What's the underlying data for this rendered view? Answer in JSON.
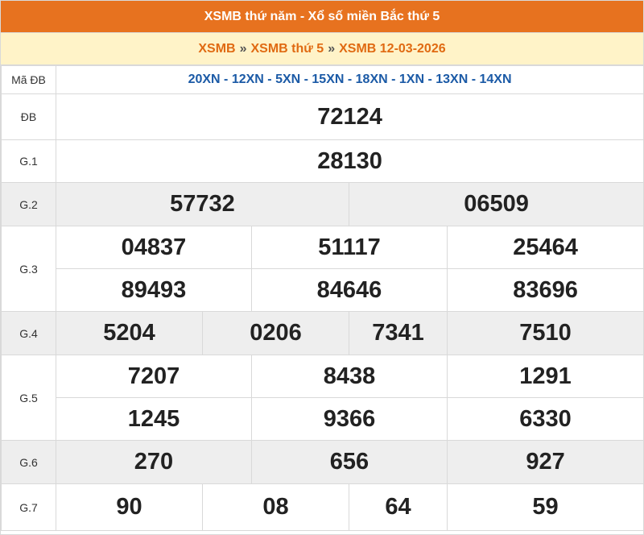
{
  "header": {
    "title": "XSMB thứ năm - Xổ số miền Bắc thứ 5"
  },
  "breadcrumb": {
    "item1": "XSMB",
    "sep": "»",
    "item2": "XSMB thứ 5",
    "item3": "XSMB 12-03-2026"
  },
  "labels": {
    "ma_db": "Mã ĐB",
    "db": "ĐB",
    "g1": "G.1",
    "g2": "G.2",
    "g3": "G.3",
    "g4": "G.4",
    "g5": "G.5",
    "g6": "G.6",
    "g7": "G.7"
  },
  "codes": "20XN - 12XN - 5XN - 15XN - 18XN - 1XN - 13XN - 14XN",
  "prizes": {
    "db": "72124",
    "g1": "28130",
    "g2": [
      "57732",
      "06509"
    ],
    "g3": [
      "04837",
      "51117",
      "25464",
      "89493",
      "84646",
      "83696"
    ],
    "g4": [
      "5204",
      "0206",
      "7341",
      "7510"
    ],
    "g5": [
      "7207",
      "8438",
      "1291",
      "1245",
      "9366",
      "6330"
    ],
    "g6": [
      "270",
      "656",
      "927"
    ],
    "g7": [
      "90",
      "08",
      "64",
      "59"
    ]
  },
  "colors": {
    "header_bg": "#e7721f",
    "breadcrumb_bg": "#fff3c8",
    "accent": "#d3520f",
    "code_blue": "#1b5aa6",
    "row_gray": "#eeeeee"
  }
}
